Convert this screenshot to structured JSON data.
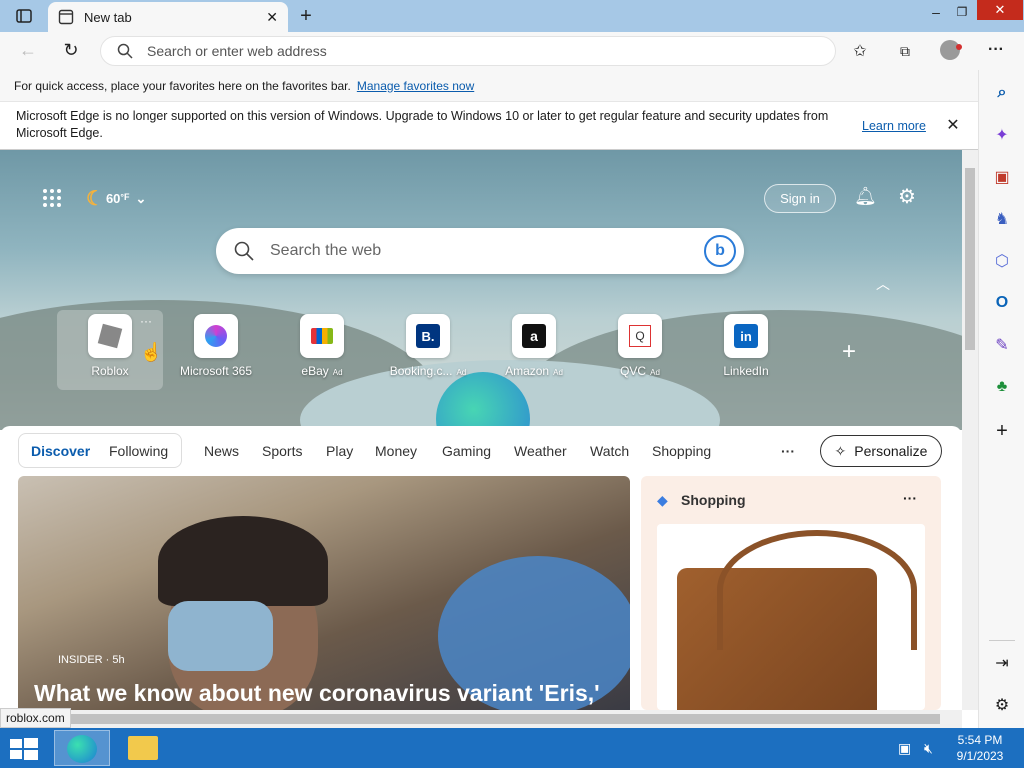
{
  "tab": {
    "title": "New tab"
  },
  "omnibox": {
    "placeholder": "Search or enter web address"
  },
  "favbar": {
    "text": "For quick access, place your favorites here on the favorites bar.",
    "link": "Manage favorites now"
  },
  "infobar": {
    "message": "Microsoft Edge is no longer supported on this version of Windows. Upgrade to Windows 10 or later to get regular feature and security updates from Microsoft Edge.",
    "link": "Learn more"
  },
  "weather": {
    "temp": "60",
    "unit": "°F"
  },
  "signin": "Sign in",
  "search": {
    "placeholder": "Search the web"
  },
  "tiles": [
    {
      "label": "Roblox",
      "ad": ""
    },
    {
      "label": "Microsoft 365",
      "ad": ""
    },
    {
      "label": "eBay",
      "ad": "Ad"
    },
    {
      "label": "Booking.c...",
      "ad": "Ad"
    },
    {
      "label": "Amazon",
      "ad": "Ad"
    },
    {
      "label": "QVC",
      "ad": "Ad"
    },
    {
      "label": "LinkedIn",
      "ad": ""
    }
  ],
  "nav": {
    "discover": "Discover",
    "following": "Following",
    "items": [
      "News",
      "Sports",
      "Play",
      "Money",
      "Gaming",
      "Weather",
      "Watch",
      "Shopping"
    ],
    "more": "···",
    "personalize": "Personalize"
  },
  "news": {
    "source": "INSIDER · 5h",
    "headline": "What we know about new coronavirus variant 'Eris,'"
  },
  "shopping": {
    "title": "Shopping",
    "more": "···"
  },
  "status": {
    "url": "roblox.com"
  },
  "taskbar": {
    "time": "5:54 PM",
    "date": "9/1/2023"
  },
  "colors": {
    "accent": "#0b5cad",
    "taskbar": "#1c6fc0",
    "tabstrip": "#a6c8e6"
  }
}
